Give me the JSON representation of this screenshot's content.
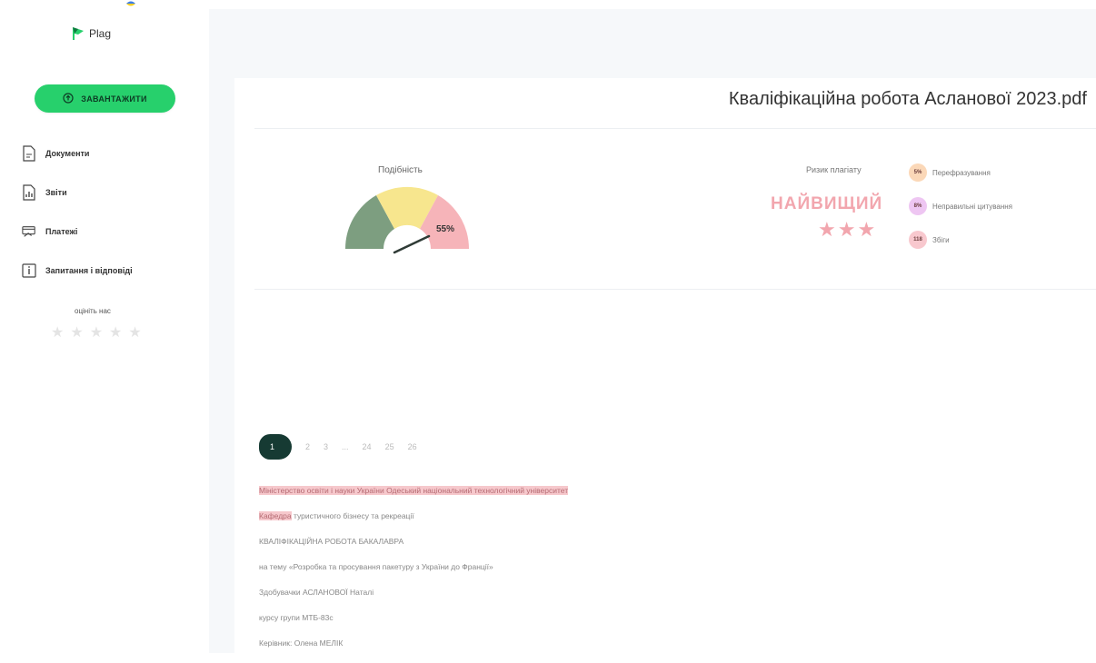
{
  "sidebar": {
    "logo_text": "Plag",
    "upload_label": "ЗАВАНТАЖИТИ",
    "items": [
      {
        "label": "Документи",
        "icon": "document-icon"
      },
      {
        "label": "Звіти",
        "icon": "report-icon"
      },
      {
        "label": "Платежі",
        "icon": "payments-icon"
      },
      {
        "label": "Запитання і відповіді",
        "icon": "info-icon"
      }
    ],
    "rate_label": "оцініть нас",
    "rate_stars": 5
  },
  "document": {
    "title": "Кваліфікаційна робота Асланової 2023.pdf"
  },
  "similarity": {
    "label": "Подібність",
    "value": "55%",
    "value_fraction": 0.55
  },
  "risk": {
    "label": "Ризик плагіату",
    "value": "НАЙВИЩИЙ",
    "stars": 3
  },
  "legend": [
    {
      "badge": "5%",
      "label": "Перефразування",
      "color": "#fbd8b8"
    },
    {
      "badge": "8%",
      "label": "Неправильні цитування",
      "color": "#eec6f2"
    },
    {
      "badge": "118",
      "label": "Збіги",
      "color": "#f8c8ce"
    }
  ],
  "pagination": {
    "active": "1",
    "pages": [
      "2",
      "3",
      "...",
      "24",
      "25",
      "26"
    ]
  },
  "content_lines": [
    {
      "highlight": "Міністерство освіти і науки України Одеський національний технологічний університет",
      "rest": ""
    },
    {
      "highlight": "Кафедра",
      "rest": " туристичного бізнесу та рекреації"
    },
    {
      "highlight": "",
      "rest": "КВАЛІФІКАЦІЙНА РОБОТА БАКАЛАВРА"
    },
    {
      "highlight": "",
      "rest": "на тему «Розробка та просування пакетуру з України до Франції»"
    },
    {
      "highlight": "",
      "rest": "Здобувачки АСЛАНОВОЇ Наталі"
    },
    {
      "highlight": "",
      "rest": "курсу групи МТБ-83с"
    },
    {
      "highlight": "",
      "rest": "Керівник: Олена МЕЛІК"
    }
  ],
  "colors": {
    "accent": "#27d06c",
    "pager_active": "#163a33",
    "risk": "#f2a6ae",
    "gauge_low": "#7d9e80",
    "gauge_mid": "#f7e68e",
    "gauge_high": "#f6b4b9"
  }
}
